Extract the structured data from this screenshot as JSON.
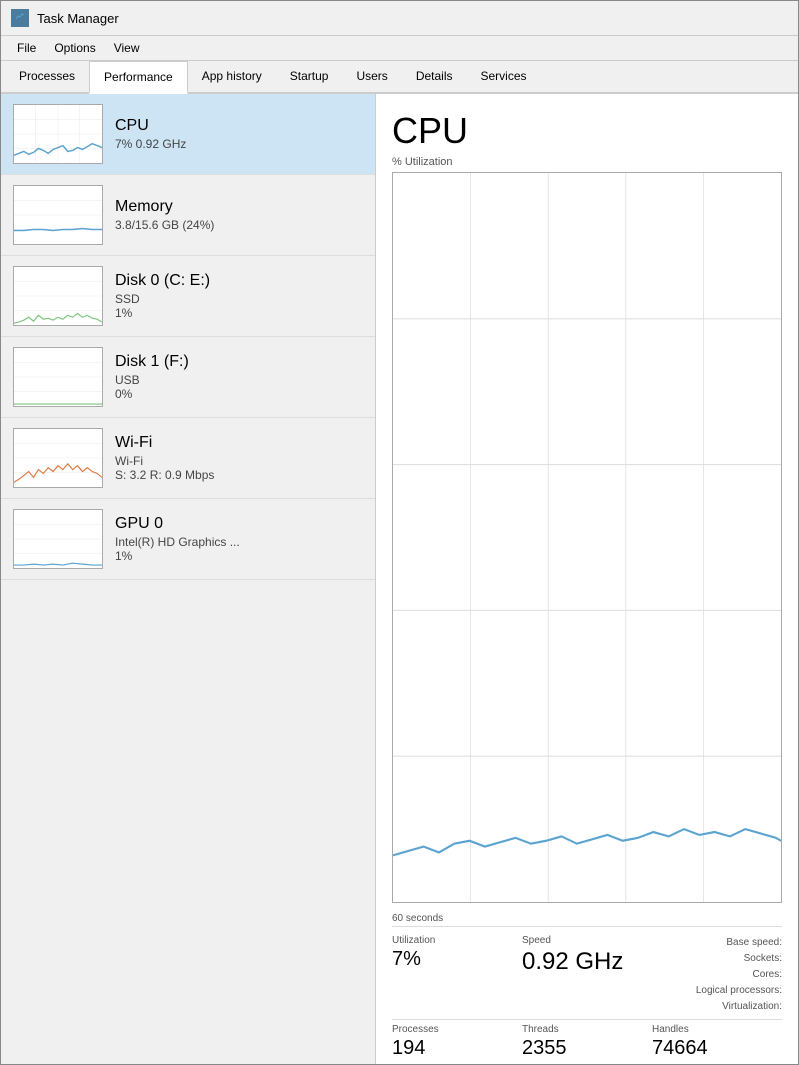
{
  "window": {
    "title": "Task Manager",
    "icon": "task-manager"
  },
  "menu": {
    "items": [
      "File",
      "Options",
      "View"
    ]
  },
  "tabs": [
    {
      "label": "Processes",
      "active": false
    },
    {
      "label": "Performance",
      "active": true
    },
    {
      "label": "App history",
      "active": false
    },
    {
      "label": "Startup",
      "active": false
    },
    {
      "label": "Users",
      "active": false
    },
    {
      "label": "Details",
      "active": false
    },
    {
      "label": "Services",
      "active": false
    }
  ],
  "sidebar": {
    "items": [
      {
        "id": "cpu",
        "name": "CPU",
        "sub1": "7% 0.92 GHz",
        "sub2": "",
        "selected": true,
        "chart_type": "cpu"
      },
      {
        "id": "memory",
        "name": "Memory",
        "sub1": "3.8/15.6 GB (24%)",
        "sub2": "",
        "selected": false,
        "chart_type": "memory"
      },
      {
        "id": "disk0",
        "name": "Disk 0 (C: E:)",
        "sub1": "SSD",
        "sub2": "1%",
        "selected": false,
        "chart_type": "disk0"
      },
      {
        "id": "disk1",
        "name": "Disk 1 (F:)",
        "sub1": "USB",
        "sub2": "0%",
        "selected": false,
        "chart_type": "disk1"
      },
      {
        "id": "wifi",
        "name": "Wi-Fi",
        "sub1": "Wi-Fi",
        "sub2": "S: 3.2  R: 0.9 Mbps",
        "selected": false,
        "chart_type": "wifi"
      },
      {
        "id": "gpu0",
        "name": "GPU 0",
        "sub1": "Intel(R) HD Graphics ...",
        "sub2": "1%",
        "selected": false,
        "chart_type": "gpu"
      }
    ]
  },
  "main": {
    "title": "CPU",
    "chart_label": "% Utilization",
    "time_label": "60 seconds",
    "stats": {
      "utilization_label": "Utilization",
      "utilization_value": "7%",
      "speed_label": "Speed",
      "speed_value": "0.92 GHz",
      "processes_label": "Processes",
      "processes_value": "194",
      "threads_label": "Threads",
      "threads_value": "2355",
      "handles_label": "Handles",
      "handles_value": "74664"
    },
    "right_stats": {
      "base_speed_label": "Base speed:",
      "sockets_label": "Sockets:",
      "cores_label": "Cores:",
      "logical_label": "Logical processors:",
      "virtualization_label": "Virtualization:"
    }
  }
}
